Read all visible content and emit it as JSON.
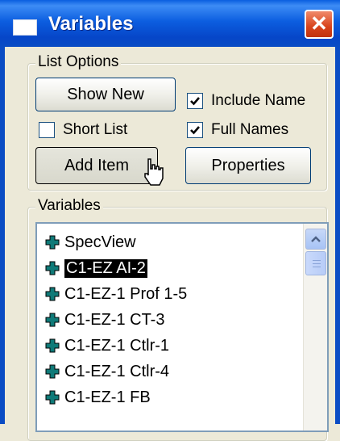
{
  "window": {
    "title": "Variables",
    "close_glyph": "✕"
  },
  "list_options": {
    "legend": "List Options",
    "show_new_label": "Show New",
    "add_item_label": "Add Item",
    "properties_label": "Properties",
    "include_name": {
      "label": "Include Name",
      "checked": true
    },
    "short_list": {
      "label": "Short List",
      "checked": false
    },
    "full_names": {
      "label": "Full Names",
      "checked": true
    }
  },
  "variables": {
    "legend": "Variables",
    "items": [
      {
        "label": "SpecView",
        "selected": false
      },
      {
        "label": "C1-EZ AI-2",
        "selected": true
      },
      {
        "label": "C1-EZ-1 Prof 1-5",
        "selected": false
      },
      {
        "label": "C1-EZ-1 CT-3",
        "selected": false
      },
      {
        "label": "C1-EZ-1 Ctlr-1",
        "selected": false
      },
      {
        "label": "C1-EZ-1 Ctlr-4",
        "selected": false
      },
      {
        "label": "C1-EZ-1 FB",
        "selected": false
      }
    ],
    "plus_icon_color": "#0f7a78"
  },
  "colors": {
    "titlebar_blue": "#0a4cc4",
    "selection_bg": "#000000",
    "close_red": "#d8431c"
  }
}
